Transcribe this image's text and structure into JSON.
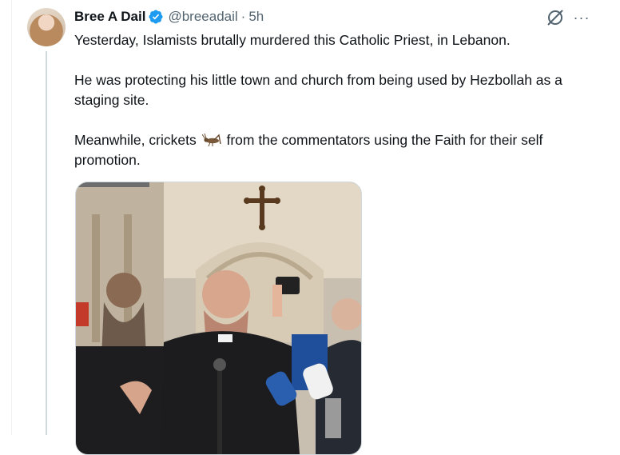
{
  "tweet": {
    "author_name": "Bree A Dail",
    "handle": "@breeadail",
    "separator": "·",
    "time": "5h",
    "paragraph1": "Yesterday, Islamists brutally murdered this Catholic Priest, in Lebanon.",
    "paragraph2": "He was protecting his little town and church from being used by Hezbollah as a staging site.",
    "paragraph3_before": "Meanwhile, crickets",
    "paragraph3_after": "from the commentators using the Faith for their self promotion.",
    "more_label": "···"
  },
  "icons": {
    "verified": "verified-badge-icon",
    "grok": "grok-icon",
    "more": "more-icon",
    "cricket": "cricket-emoji-icon"
  },
  "colors": {
    "verified_blue": "#1d9bf0",
    "secondary_text": "#536471",
    "thread_line": "#cfd9de"
  }
}
